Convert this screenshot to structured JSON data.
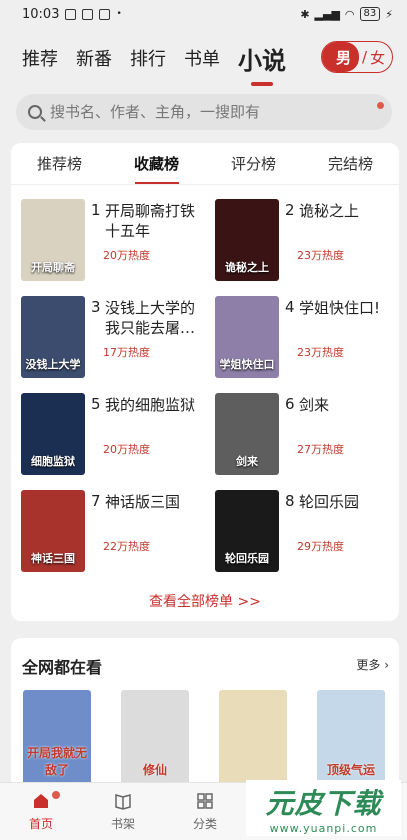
{
  "status": {
    "time": "10:03",
    "battery": "83"
  },
  "topnav": {
    "tabs": [
      "推荐",
      "新番",
      "排行",
      "书单",
      "小说"
    ],
    "active_index": 4,
    "gender": {
      "male": "男",
      "sep": "/",
      "female": "女"
    }
  },
  "search": {
    "placeholder": "搜书名、作者、主角，一搜即有"
  },
  "ranking": {
    "tabs": [
      "推荐榜",
      "收藏榜",
      "评分榜",
      "完结榜"
    ],
    "active_index": 1,
    "books": [
      {
        "rank": "1",
        "title": "开局聊斋打铁十五年",
        "heat": "20万热度",
        "cover_text": "开局聊斋",
        "color": "#d9d2c0"
      },
      {
        "rank": "2",
        "title": "诡秘之上",
        "heat": "23万热度",
        "cover_text": "诡秘之上",
        "color": "#3a1414"
      },
      {
        "rank": "3",
        "title": "没钱上大学的我只能去屠…",
        "heat": "17万热度",
        "cover_text": "没钱上大学",
        "color": "#3b4c6e"
      },
      {
        "rank": "4",
        "title": "学姐快住口!",
        "heat": "23万热度",
        "cover_text": "学姐快住口",
        "color": "#8d7fa8"
      },
      {
        "rank": "5",
        "title": "我的细胞监狱",
        "heat": "20万热度",
        "cover_text": "细胞监狱",
        "color": "#1b2f52"
      },
      {
        "rank": "6",
        "title": "剑来",
        "heat": "27万热度",
        "cover_text": "剑来",
        "color": "#5e5e5e"
      },
      {
        "rank": "7",
        "title": "神话版三国",
        "heat": "22万热度",
        "cover_text": "神话三国",
        "color": "#a8332c"
      },
      {
        "rank": "8",
        "title": "轮回乐园",
        "heat": "29万热度",
        "cover_text": "轮回乐园",
        "color": "#1a1a1a"
      }
    ],
    "view_all": "查看全部榜单 >>"
  },
  "watching": {
    "title": "全网都在看",
    "more": "更多",
    "covers": [
      {
        "cover_text": "开局我就无敌了",
        "color": "#6f8ec9"
      },
      {
        "cover_text": "修仙",
        "color": "#dcdcdc"
      },
      {
        "cover_text": "",
        "color": "#e9dcb9"
      },
      {
        "cover_text": "顶级气运",
        "color": "#c4d8ea"
      }
    ]
  },
  "tabbar": {
    "items": [
      {
        "label": "首页",
        "icon": "home-icon"
      },
      {
        "label": "书架",
        "icon": "bookshelf-icon"
      },
      {
        "label": "分类",
        "icon": "category-icon"
      }
    ],
    "active_index": 0
  },
  "watermark": {
    "main": "元皮下载",
    "sub": "www.yuanpi.com"
  },
  "colors": {
    "accent": "#c9302c",
    "heat": "#c0392b"
  }
}
